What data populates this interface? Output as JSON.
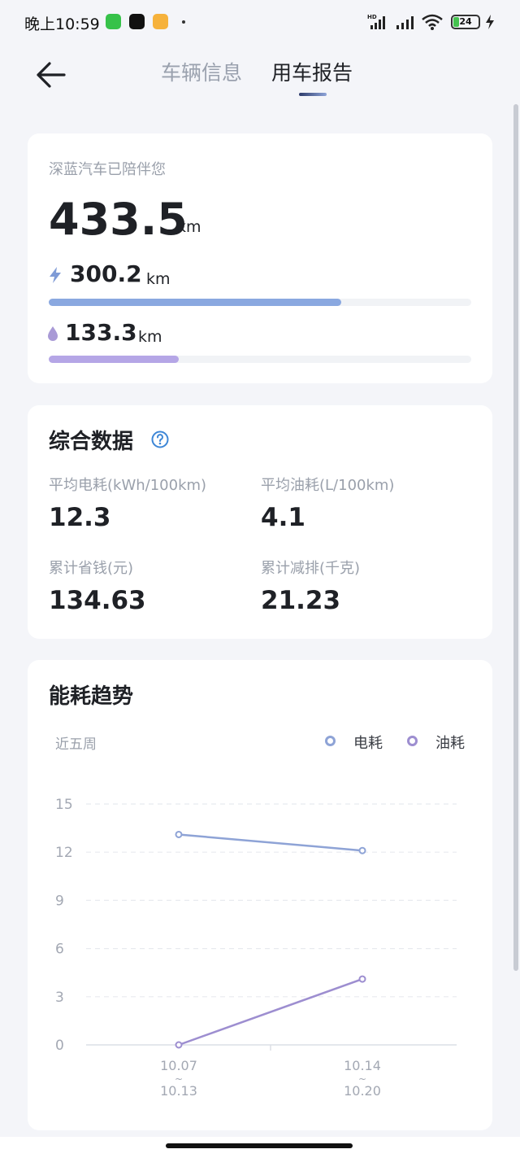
{
  "status_bar": {
    "time": "晚上10:59",
    "network_badge": "HD",
    "battery_level": "24",
    "battery_fraction": 0.24,
    "icons": [
      "charging-app-icon",
      "tiktok-icon",
      "notes-app-icon",
      "signal-icon",
      "wifi-icon",
      "battery-icon",
      "charging-icon"
    ]
  },
  "header": {
    "back_icon": "arrow-left-icon",
    "tabs": [
      {
        "label": "车辆信息",
        "active": false
      },
      {
        "label": "用车报告",
        "active": true
      }
    ]
  },
  "mileage": {
    "caption": "深蓝汽车已陪伴您",
    "total": "433.5",
    "unit": "km",
    "electric": {
      "value": "300.2",
      "unit": "km",
      "icon": "lightning-icon",
      "fraction": 0.6925,
      "color": "#8aa8e0"
    },
    "fuel": {
      "value": "133.3",
      "unit": "km",
      "icon": "droplet-icon",
      "fraction": 0.3075,
      "color": "#b5a6e6"
    }
  },
  "summary": {
    "title": "综合数据",
    "help_icon": "question-icon",
    "metrics": [
      {
        "label": "平均电耗(kWh/100km)",
        "value": "12.3"
      },
      {
        "label": "平均油耗(L/100km)",
        "value": "4.1"
      },
      {
        "label": "累计省钱(元)",
        "value": "134.63"
      },
      {
        "label": "累计减排(千克)",
        "value": "21.23"
      }
    ]
  },
  "trend": {
    "title": "能耗趋势",
    "period": "近五周",
    "legend": [
      {
        "name": "电耗",
        "color": "#8ea3d6"
      },
      {
        "name": "油耗",
        "color": "#9d8ed0"
      }
    ]
  },
  "chart_data": {
    "type": "line",
    "title": "能耗趋势",
    "xlabel": "",
    "ylabel": "",
    "ylim": [
      0,
      15
    ],
    "yticks": [
      "15",
      "12",
      "9",
      "6",
      "3",
      "0"
    ],
    "grid": true,
    "legend_position": "top-right",
    "categories": [
      {
        "from": "10.07",
        "sep": "~",
        "to": "10.13"
      },
      {
        "from": "10.14",
        "sep": "~",
        "to": "10.20"
      }
    ],
    "series": [
      {
        "name": "电耗",
        "color": "#8ea3d6",
        "values": [
          13.1,
          12.1
        ]
      },
      {
        "name": "油耗",
        "color": "#9d8ed0",
        "values": [
          0.0,
          4.1
        ]
      }
    ]
  }
}
